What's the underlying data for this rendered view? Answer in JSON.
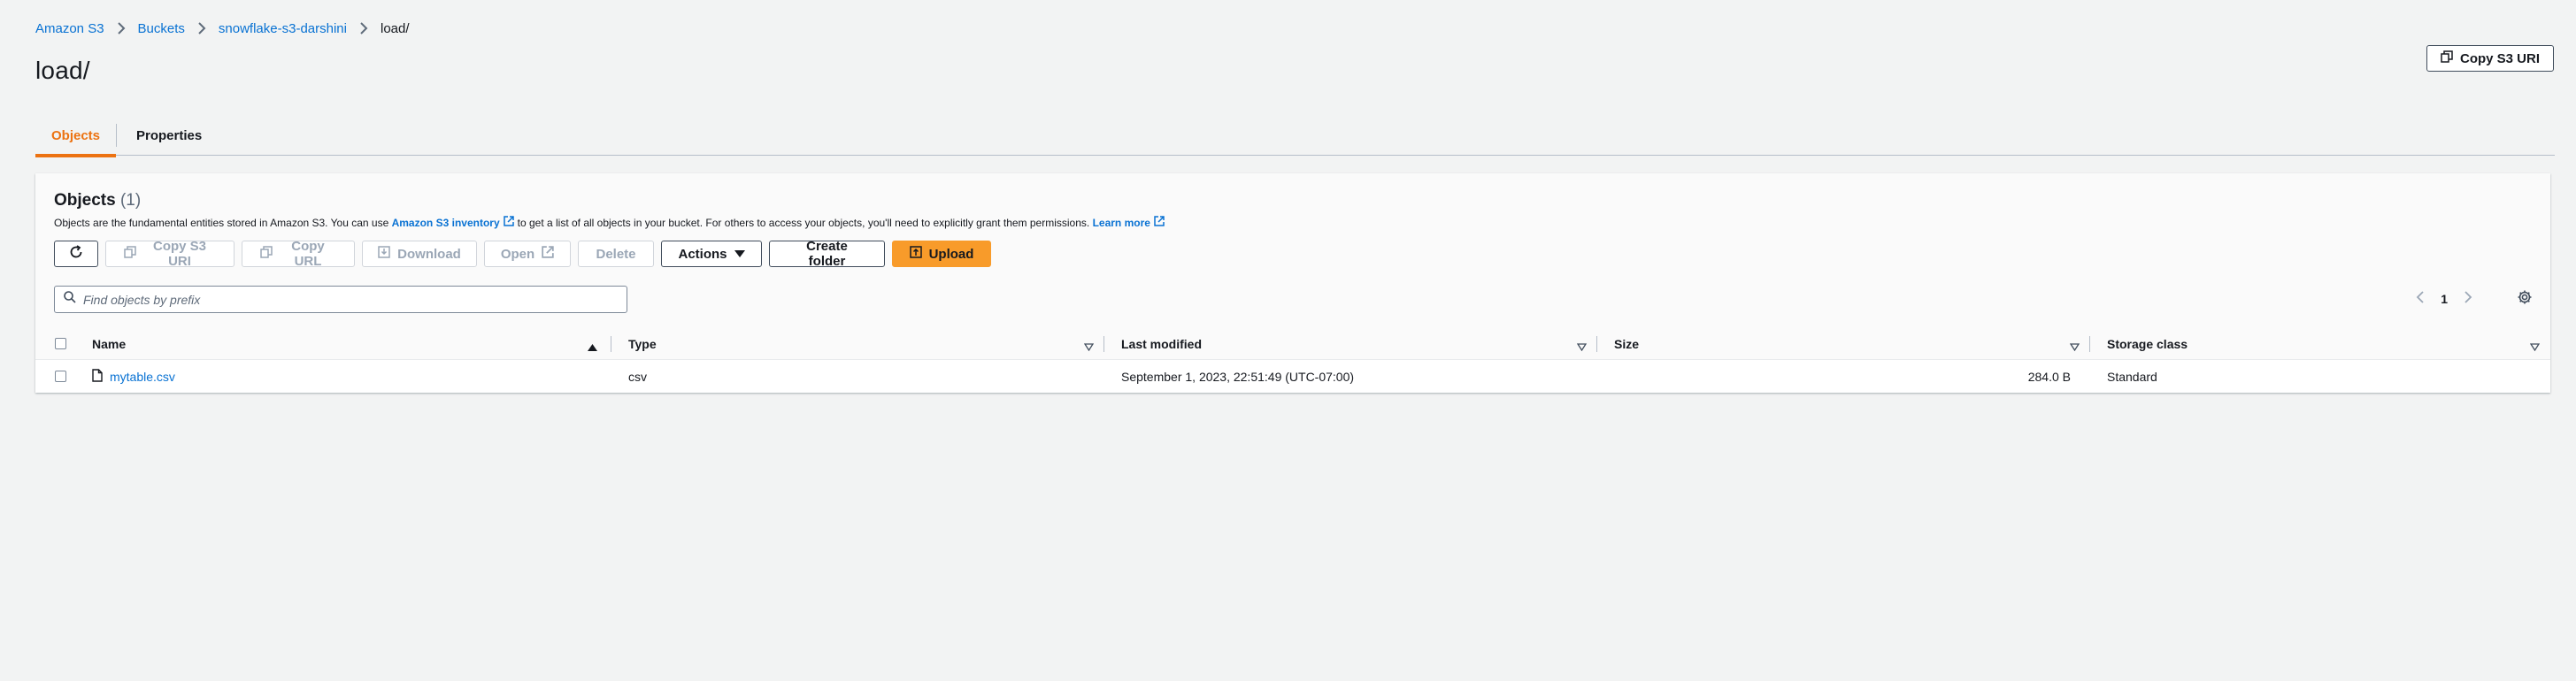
{
  "breadcrumb": {
    "items": [
      "Amazon S3",
      "Buckets",
      "snowflake-s3-darshini"
    ],
    "current": "load/"
  },
  "page": {
    "title": "load/",
    "copy_s3_uri_label": "Copy S3 URI"
  },
  "tabs": [
    {
      "label": "Objects",
      "active": true
    },
    {
      "label": "Properties",
      "active": false
    }
  ],
  "objects_panel": {
    "title": "Objects",
    "count": "(1)",
    "description_prefix": "Objects are the fundamental entities stored in Amazon S3. You can use",
    "inventory_link": "Amazon S3 inventory",
    "description_middle": "to get a list of all objects in your bucket. For others to access your objects, you'll need to explicitly grant them permissions.",
    "learn_more": "Learn more"
  },
  "toolbar": {
    "copy_s3_uri": "Copy S3 URI",
    "copy_url": "Copy URL",
    "download": "Download",
    "open": "Open",
    "delete": "Delete",
    "actions": "Actions",
    "create_folder": "Create folder",
    "upload": "Upload"
  },
  "search": {
    "placeholder": "Find objects by prefix",
    "value": ""
  },
  "pagination": {
    "current_page": "1"
  },
  "table": {
    "columns": [
      "Name",
      "Type",
      "Last modified",
      "Size",
      "Storage class"
    ],
    "rows": [
      {
        "name": "mytable.csv",
        "type": "csv",
        "last_modified": "September 1, 2023, 22:51:49 (UTC-07:00)",
        "size": "284.0 B",
        "storage_class": "Standard"
      }
    ]
  },
  "colors": {
    "accent": "#ec7211",
    "link": "#0972d3",
    "primary_button": "#f89b2a"
  }
}
